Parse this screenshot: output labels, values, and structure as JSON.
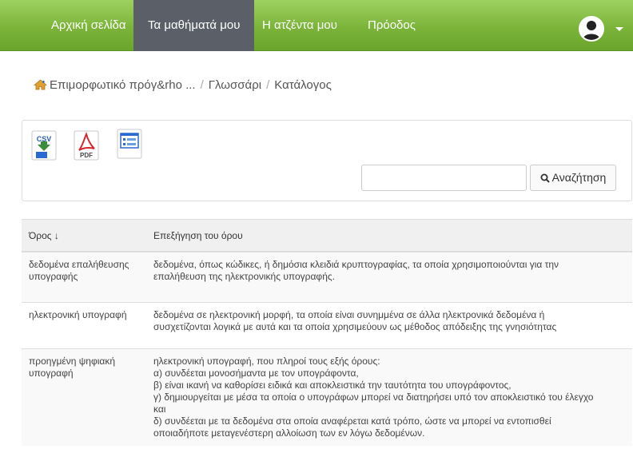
{
  "nav": {
    "items": [
      {
        "label": "Αρχική σελίδα",
        "active": false
      },
      {
        "label": "Τα μαθήματά μου",
        "active": true
      },
      {
        "label": "Η ατζέντα μου",
        "active": false
      },
      {
        "label": "Πρόοδος",
        "active": false
      }
    ]
  },
  "breadcrumb": {
    "items": [
      "Επιμορφωτικό πρόγ&rho ...",
      "Γλωσσάρι",
      "Κατάλογος"
    ],
    "separator": "/"
  },
  "toolbar": {
    "export_csv_label": "CSV",
    "export_pdf_label": "PDF",
    "search_placeholder": "",
    "search_value": "",
    "search_button_label": "Αναζήτηση"
  },
  "table": {
    "headers": [
      "Όρος ↓",
      "Επεξήγηση του όρου"
    ],
    "rows": [
      {
        "term": [
          "δεδομένα επαλήθευσης",
          "υπογραφής"
        ],
        "definition": [
          "δεδομένα, όπως κώδικες, ή δημόσια κλειδιά κρυπτογραφίας, τα οποία χρησιμοποιούνται για την",
          "επαλήθευση της ηλεκτρονικής υπογραφής."
        ]
      },
      {
        "term": [
          "ηλεκτρονική υπογραφή"
        ],
        "definition": [
          "δεδομένα σε ηλεκτρονική μορφή, τα οποία είναι συνημμένα σε άλλα ηλεκτρονικά δεδομένα ή",
          "συσχετίζονται λογικά με αυτά και τα οποία χρησιμεύουν ως μέθοδος απόδειξης της γνησιότητας"
        ]
      },
      {
        "term": [
          "προηγμένη ψηφιακή",
          "υπογραφή"
        ],
        "definition": [
          "ηλεκτρονική υπογραφή, που πληροί τους εξής όρους:",
          "α) συνδέεται μονοσήμαντα με τον υπογράφοντα,",
          "β) είναι ικανή να καθορίσει ειδικά και αποκλειστικά την ταυτότητα του υπογράφοντος,",
          "γ) δημιουργείται με μέσα τα οποία ο υπογράφων μπορεί να διατηρήσει υπό τον αποκλειστικό του έλεγχο",
          "και",
          "δ) συνδέεται με τα δεδομένα στα οποία αναφέρεται κατά τρόπο, ώστε να μπορεί να εντοπισθεί",
          "οποιαδήποτε μεταγενέστερη αλλοίωση των εν λόγω δεδομένων."
        ]
      }
    ]
  },
  "colors": {
    "nav_green": "#7cb43a",
    "nav_active": "#5b6068"
  }
}
